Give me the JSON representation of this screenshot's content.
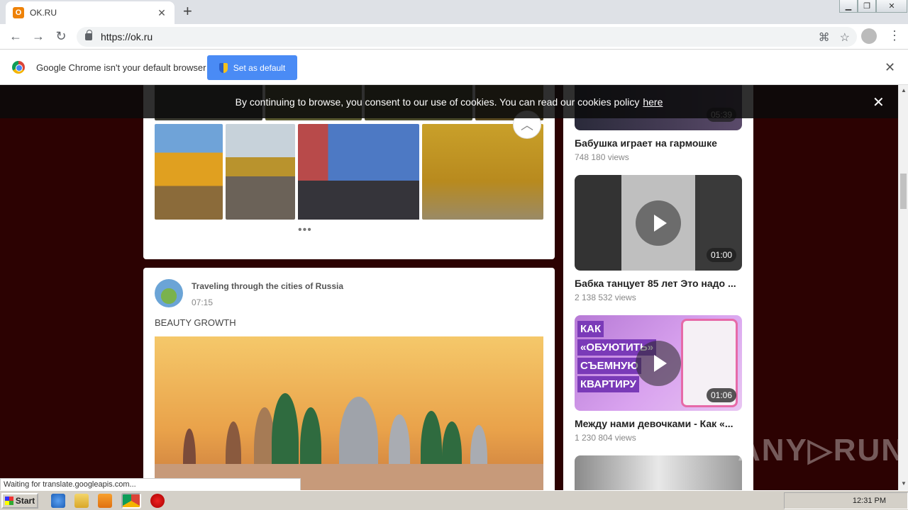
{
  "browser": {
    "tab_title": "OK.RU",
    "tab_favicon": "ok-logo-icon",
    "url": "https://ok.ru",
    "infobar_text": "Google Chrome isn't your default browser",
    "set_default_label": "Set as default",
    "status_text": "Waiting for translate.googleapis.com..."
  },
  "cookie_bar": {
    "text": "By continuing to browse, you consent to our use of cookies. You can read our cookies policy",
    "link": "here"
  },
  "post": {
    "group_name": "Traveling through the cities of Russia",
    "time": "07:15",
    "text": "BEAUTY GROWTH"
  },
  "videos": [
    {
      "title": "Бабушка играет на гармошке",
      "views": "748 180 views",
      "duration": "05:39"
    },
    {
      "title": "Бабка танцует 85 лет Это надо ...",
      "views": "2 138 532 views",
      "duration": "01:00"
    },
    {
      "title": "Между нами девочками - Как «...",
      "views": "1 230 804 views",
      "duration": "01:06"
    }
  ],
  "promo_lines": [
    "КАК",
    "«ОБУЮТИТЬ»",
    "СЪЕМНУЮ",
    "КВАРТИРУ"
  ],
  "watermark": "ANY▷RUN",
  "taskbar": {
    "start_label": "Start",
    "clock": "12:31 PM"
  },
  "colors": {
    "page_background": "#2c0202",
    "chrome_button": "#4a8bf5",
    "ok_orange": "#ee8208"
  }
}
